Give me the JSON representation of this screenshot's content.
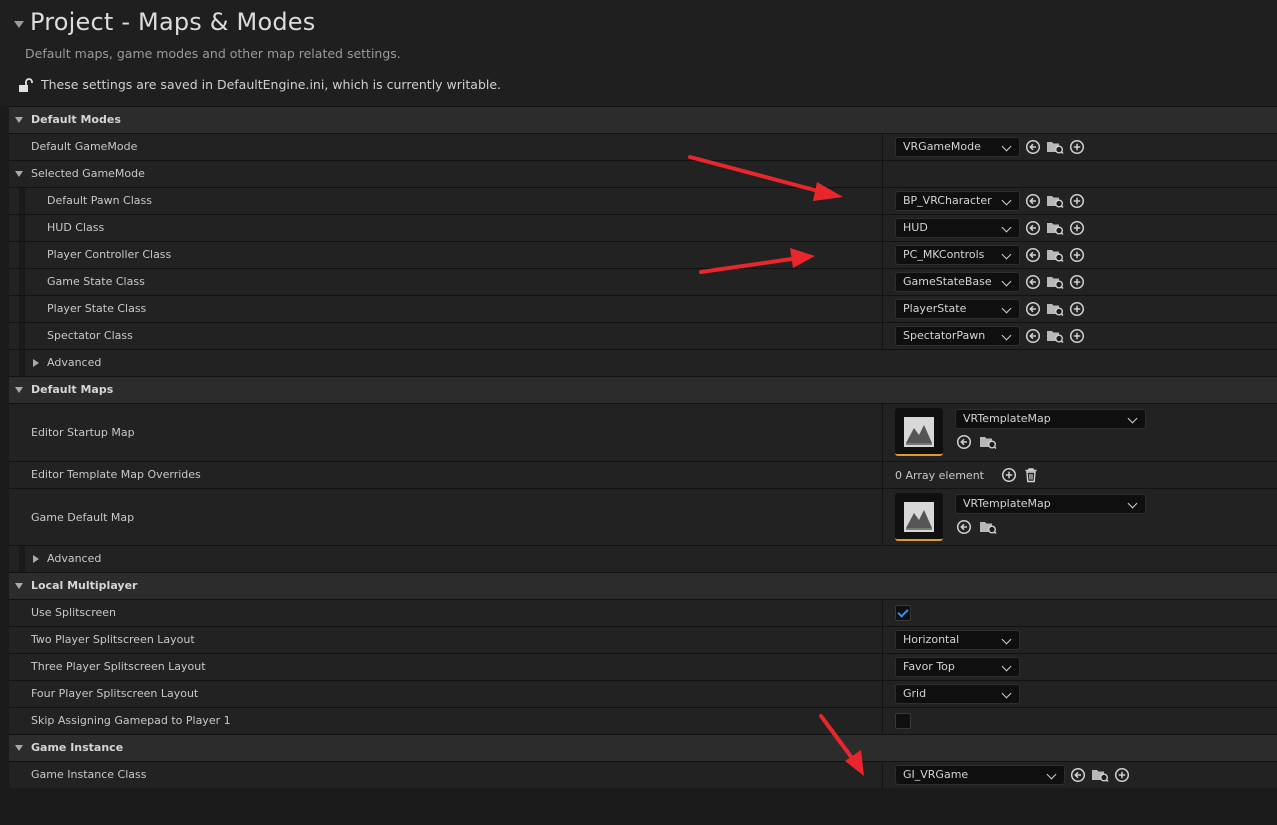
{
  "header": {
    "title": "Project - Maps & Modes",
    "subtitle": "Default maps, game modes and other map related settings.",
    "saved_note": "These settings are saved in DefaultEngine.ini, which is currently writable."
  },
  "default_modes": {
    "label": "Default Modes",
    "default_gamemode": {
      "label": "Default GameMode",
      "value": "VRGameMode"
    },
    "selected_gamemode": {
      "label": "Selected GameMode",
      "pawn": {
        "label": "Default Pawn Class",
        "value": "BP_VRCharacter"
      },
      "hud": {
        "label": "HUD Class",
        "value": "HUD"
      },
      "controller": {
        "label": "Player Controller Class",
        "value": "PC_MKControls"
      },
      "game_state": {
        "label": "Game State Class",
        "value": "GameStateBase"
      },
      "player_state": {
        "label": "Player State Class",
        "value": "PlayerState"
      },
      "spectator": {
        "label": "Spectator Class",
        "value": "SpectatorPawn"
      },
      "advanced": "Advanced"
    }
  },
  "default_maps": {
    "label": "Default Maps",
    "editor_startup": {
      "label": "Editor Startup Map",
      "value": "VRTemplateMap"
    },
    "template_overrides": {
      "label": "Editor Template Map Overrides",
      "value": "0 Array element"
    },
    "game_default": {
      "label": "Game Default Map",
      "value": "VRTemplateMap"
    },
    "advanced": "Advanced"
  },
  "local_multiplayer": {
    "label": "Local Multiplayer",
    "use_splitscreen": {
      "label": "Use Splitscreen",
      "checked": true
    },
    "two_player": {
      "label": "Two Player Splitscreen Layout",
      "value": "Horizontal"
    },
    "three_player": {
      "label": "Three Player Splitscreen Layout",
      "value": "Favor Top"
    },
    "four_player": {
      "label": "Four Player Splitscreen Layout",
      "value": "Grid"
    },
    "skip_gamepad": {
      "label": "Skip Assigning Gamepad to Player 1",
      "checked": false
    }
  },
  "game_instance": {
    "label": "Game Instance",
    "class": {
      "label": "Game Instance Class",
      "value": "GI_VRGame"
    }
  },
  "colors": {
    "annotation_arrow": "#e8262c",
    "thumb_accent": "#e09a2a",
    "check": "#3a8ee6"
  }
}
